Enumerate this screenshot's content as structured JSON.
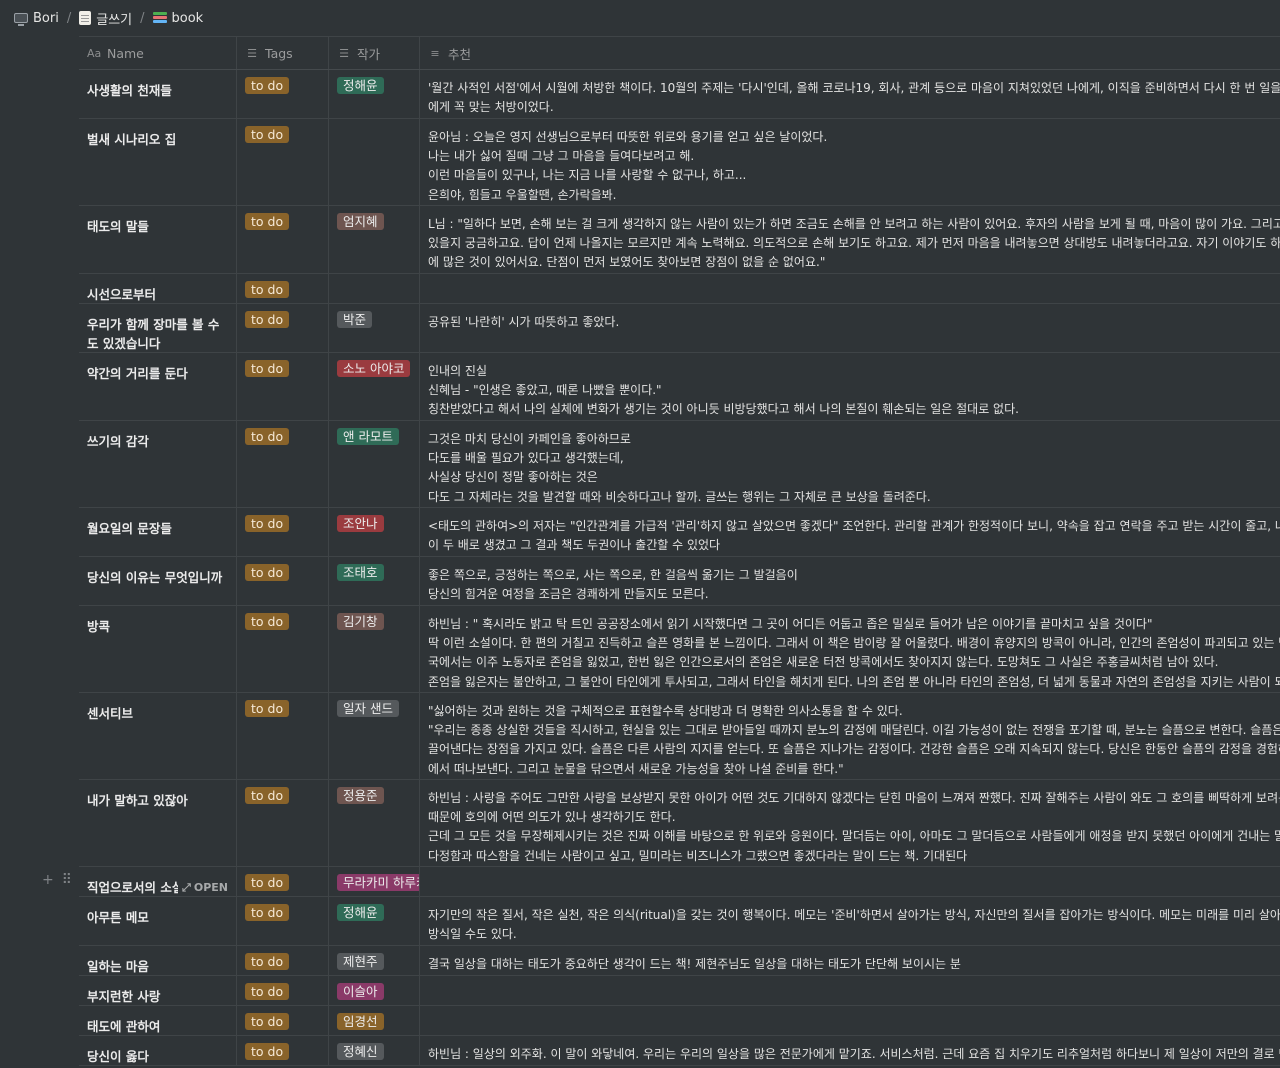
{
  "breadcrumb": [
    {
      "label": "Bori",
      "icon": "monitor-icon"
    },
    {
      "label": "글쓰기",
      "icon": "memo-icon"
    },
    {
      "label": "book",
      "icon": "books-icon"
    }
  ],
  "breadcrumb_separator": "/",
  "columns": {
    "name": "Name",
    "name_icon": "Aa",
    "tags": "Tags",
    "author": "작가",
    "recommend": "추천"
  },
  "colors": {
    "background": "#2f3437",
    "todo_tag": "#89632a"
  },
  "open_label": "OPEN",
  "rows": [
    {
      "name": "사생활의 천재들",
      "tag": "to do",
      "author": "정해윤",
      "author_color": "#2f6b57",
      "rec": "'월간 사적인 서점'에서 시월에 처방한 책이다. 10월의 주제는 '다시'인데, 올해 코로나19, 회사, 관계 등으로 마음이 지쳐있었던 나에게, 이직을 준비하면서 다시 한 번 일을 시작할 나\n에게 꼭 맞는 처방이었다."
    },
    {
      "name": "벌새 시나리오 집",
      "tag": "to do",
      "author": "",
      "author_color": "",
      "rec": "윤아님 : 오늘은 영지 선생님으로부터 따뜻한 위로와 용기를 얻고 싶은 날이었다.\n나는 내가 싫어 질때 그냥 그 마음을 들여다보려고 해.\n이런 마음들이 있구나, 나는 지금 나를 사랑할 수 없구나, 하고...\n은희야, 힘들고 우울할땐, 손가락을봐."
    },
    {
      "name": "태도의 말들",
      "tag": "to do",
      "author": "엄지혜",
      "author_color": "#6e5550",
      "rec": "L님 : \"일하다 보면, 손해 보는 걸 크게 생각하지 않는 사람이 있는가 하면 조금도 손해를 안 보려고 하는 사람이 있어요. 후자의 사람을 보게 될 때, 마음이 많이 가요. 그리고 왜\n있을지 궁금하고요. 답이 언제 나올지는 모르지만 계속 노력해요. 의도적으로 손해 보기도 하고요. 제가 먼저 마음을 내려놓으면 상대방도 내려놓더라고요. 자기 이야기도 하고\n에 많은 것이 있어서요. 단점이 먼저 보였어도 찾아보면 장점이 없을 순 없어요.\""
    },
    {
      "name": "시선으로부터",
      "tag": "to do",
      "author": "",
      "author_color": "",
      "rec": ""
    },
    {
      "name": "우리가 함께 장마를 볼 수도 있겠습니다",
      "tag": "to do",
      "author": "박준",
      "author_color": "#55595c",
      "rec": "공유된 '나란히' 시가 따뜻하고 좋았다."
    },
    {
      "name": "약간의 거리를 둔다",
      "tag": "to do",
      "author": "소노 아야코",
      "author_color": "#9a3b3f",
      "rec": "인내의 진실\n신혜님 - \"인생은 좋았고, 때론 나빴을 뿐이다.\"\n칭찬받았다고 해서 나의 실체에 변화가 생기는 것이 아니듯 비방당했다고 해서 나의 본질이 훼손되는 일은 절대로 없다."
    },
    {
      "name": "쓰기의 감각",
      "tag": "to do",
      "author": "앤 라모트",
      "author_color": "#2f6b57",
      "rec": "그것은 마치 당신이 카페인을 좋아하므로\n다도를 배울 필요가 있다고 생각했는데,\n사실상 당신이 정말 좋아하는 것은\n다도 그 자체라는 것을 발견할 때와 비슷하다고나 할까. 글쓰는 행위는 그 자체로 큰 보상을 돌려준다."
    },
    {
      "name": "월요일의 문장들",
      "tag": "to do",
      "author": "조안나",
      "author_color": "#9a3b3f",
      "rec": "<태도의 관하여>의 저자는 \"인간관계를 가급적 '관리'하지 않고 살았으면 좋겠다\" 조언한다. 관리할 관계가 한정적이다 보니, 약속을 잡고 연락을 주고 받는 시간이 줄고, 나를\n이 두 배로 생겼고 그 결과 책도 두권이나 출간할 수 있었다"
    },
    {
      "name": "당신의 이유는 무엇입니까",
      "tag": "to do",
      "author": "조태호",
      "author_color": "#2f6b57",
      "rec": "좋은 쪽으로, 긍정하는 쪽으로, 사는 쪽으로, 한 걸음씩 옮기는 그 발걸음이\n당신의 힘겨운 여정을 조금은 경쾌하게 만들지도 모른다."
    },
    {
      "name": "방콕",
      "tag": "to do",
      "author": "김기창",
      "author_color": "#6e5550",
      "rec": "하빈님 : \" 혹시라도 밝고 탁 트인 공공장소에서 읽기 시작했다면 그 곳이 어디든 어둡고 좁은 밀실로 들어가 남은 이야기를 끝마치고 싶을 것이다\"\n딱 이런 소설이다. 한 편의 거칠고 진득하고 슬픈 영화를 본 느낌이다. 그래서 이 책은 밤이랑 잘 어울렸다. 배경이 휴양지의 방콕이 아니라, 인간의 존엄성이 파괴되고 있는 방\n국에서는 이주 노동자로 존엄을 잃었고, 한번 잃은 인간으로서의 존엄은 새로운 터전 방콕에서도 찾아지지 않는다. 도망쳐도 그 사실은 주홍글씨처럼 남아 있다.\n존엄을 잃은자는 불안하고, 그 불안이 타인에게 투사되고, 그래서 타인을 해치게 된다. 나의 존엄 뿐 아니라 타인의 존엄성, 더 넓게 동물과 자연의 존엄성을 지키는 사람이 되고"
    },
    {
      "name": "센서티브",
      "tag": "to do",
      "author": "일자 샌드",
      "author_color": "#55595c",
      "rec": "\"싫어하는 것과 원하는 것을 구체적으로 표현할수록 상대방과 더 명확한 의사소통을 할 수 있다.\n\"우리는 종종 상실한 것들을 직시하고, 현실을 있는 그대로 받아들일 때까지 분노의 감정에 매달린다. 이길 가능성이 없는 전쟁을 포기할 때, 분노는 슬픔으로 변한다. 슬픔은\n끌어낸다는 장점을 가지고 있다. 슬픔은 다른 사람의 지지를 얻는다. 또 슬픔은 지나가는 감정이다. 건강한 슬픔은 오래 지속되지 않는다. 당신은 한동안 슬픔의 감정을 경험하\n에서 떠나보낸다. 그리고 눈물을 닦으면서 새로운 가능성을 찾아 나설 준비를 한다.\""
    },
    {
      "name": "내가 말하고 있잖아",
      "tag": "to do",
      "author": "정용준",
      "author_color": "#6e5550",
      "rec": "하빈님 : 사랑을 주어도 그만한 사랑을 보상받지 못한 아이가 어떤 것도 기대하지 않겠다는 닫힌 마음이 느껴져 짠했다. 진짜 잘해주는 사람이 와도 그 호의를 삐딱하게 보려는\n때문에 호의에 어떤 의도가 있나 생각하기도 한다.\n근데 그 모든 것을 무장해제시키는 것은 진짜 이해를 바탕으로 한 위로와 응원이다. 말더듬는 아이, 아마도 그 말더듬으로 사람들에게 애정을 받지 못했던 아이에게 건내는 말\n다정함과 따스함을 건네는 사람이고 싶고, 밀미라는 비즈니스가 그랬으면 좋겠다라는 말이 드는 책. 기대된다"
    },
    {
      "name": "직업으로서의 소설가",
      "tag": "to do",
      "author": "무라카미 하루키",
      "author_color": "#8a3a68",
      "rec": "",
      "hover": true
    },
    {
      "name": "아무튼 메모",
      "tag": "to do",
      "author": "정해윤",
      "author_color": "#2f6b57",
      "rec": "자기만의 작은 질서, 작은 실천, 작은 의식(ritual)을 갖는 것이 행복이다. 메모는 '준비'하면서 살아가는 방식, 자신만의 질서를 잡아가는 방식이다. 메모는 미래를 미리 살아가\n방식일 수도 있다."
    },
    {
      "name": "일하는 마음",
      "tag": "to do",
      "author": "제현주",
      "author_color": "#55595c",
      "rec": "결국 일상을 대하는 태도가 중요하단 생각이 드는 책! 제현주님도 일상을 대하는 태도가 단단해 보이시는 분"
    },
    {
      "name": "부지런한 사랑",
      "tag": "to do",
      "author": "이슬아",
      "author_color": "#8a3a68",
      "rec": ""
    },
    {
      "name": "태도에 관하여",
      "tag": "to do",
      "author": "임경선",
      "author_color": "#89632a",
      "rec": ""
    },
    {
      "name": "당신이 옳다",
      "tag": "to do",
      "author": "정혜신",
      "author_color": "#55595c",
      "rec": "하빈님 : 일상의 외주화. 이 말이 와닿네여. 우리는 우리의 일상을 많은 전문가에게 맡기죠. 서비스처럼. 근데 요즘 집 치우기도 리추얼처럼 하다보니 제 일상이 저만의 결로 만"
    }
  ]
}
